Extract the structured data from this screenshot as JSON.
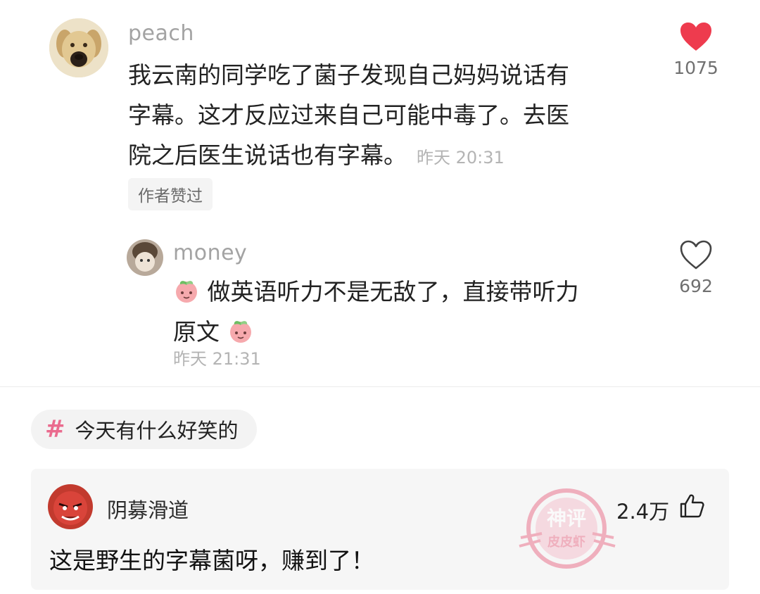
{
  "top_comment": {
    "username": "peach",
    "text": "我云南的同学吃了菌子发现自己妈妈说话有字幕。这才反应过来自己可能中毒了。去医院之后医生说话也有字幕。",
    "line1": "我云南的同学吃了菌子发现自己妈妈说话有",
    "line2": "字幕。这才反应过来自己可能中毒了。去医",
    "line3": "院之后医生说话也有字幕。",
    "timestamp": "昨天 20:31",
    "badge": "作者赞过",
    "like_count": "1075",
    "like_icon": "heart-filled-icon",
    "like_color": "#ee3b4e"
  },
  "reply": {
    "username": "money",
    "line1": "做英语听力不是无敌了，直接带听力",
    "line2": "原文",
    "timestamp": "昨天 21:31",
    "emoji": "peach-emoji",
    "like_count": "692",
    "like_icon": "heart-outline-icon"
  },
  "hashtag": {
    "icon": "hash-icon",
    "text": "今天有什么好笑的",
    "color": "#ea6b8e"
  },
  "bottom_comment": {
    "username": "阴募滑道",
    "text": "这是野生的字幕菌呀，赚到了！",
    "like_count": "2.4万",
    "like_icon": "thumbs-up-icon",
    "watermark_text_top": "神评",
    "watermark_text_bottom": "皮皮虾",
    "watermark_color": "#e85a7a"
  }
}
